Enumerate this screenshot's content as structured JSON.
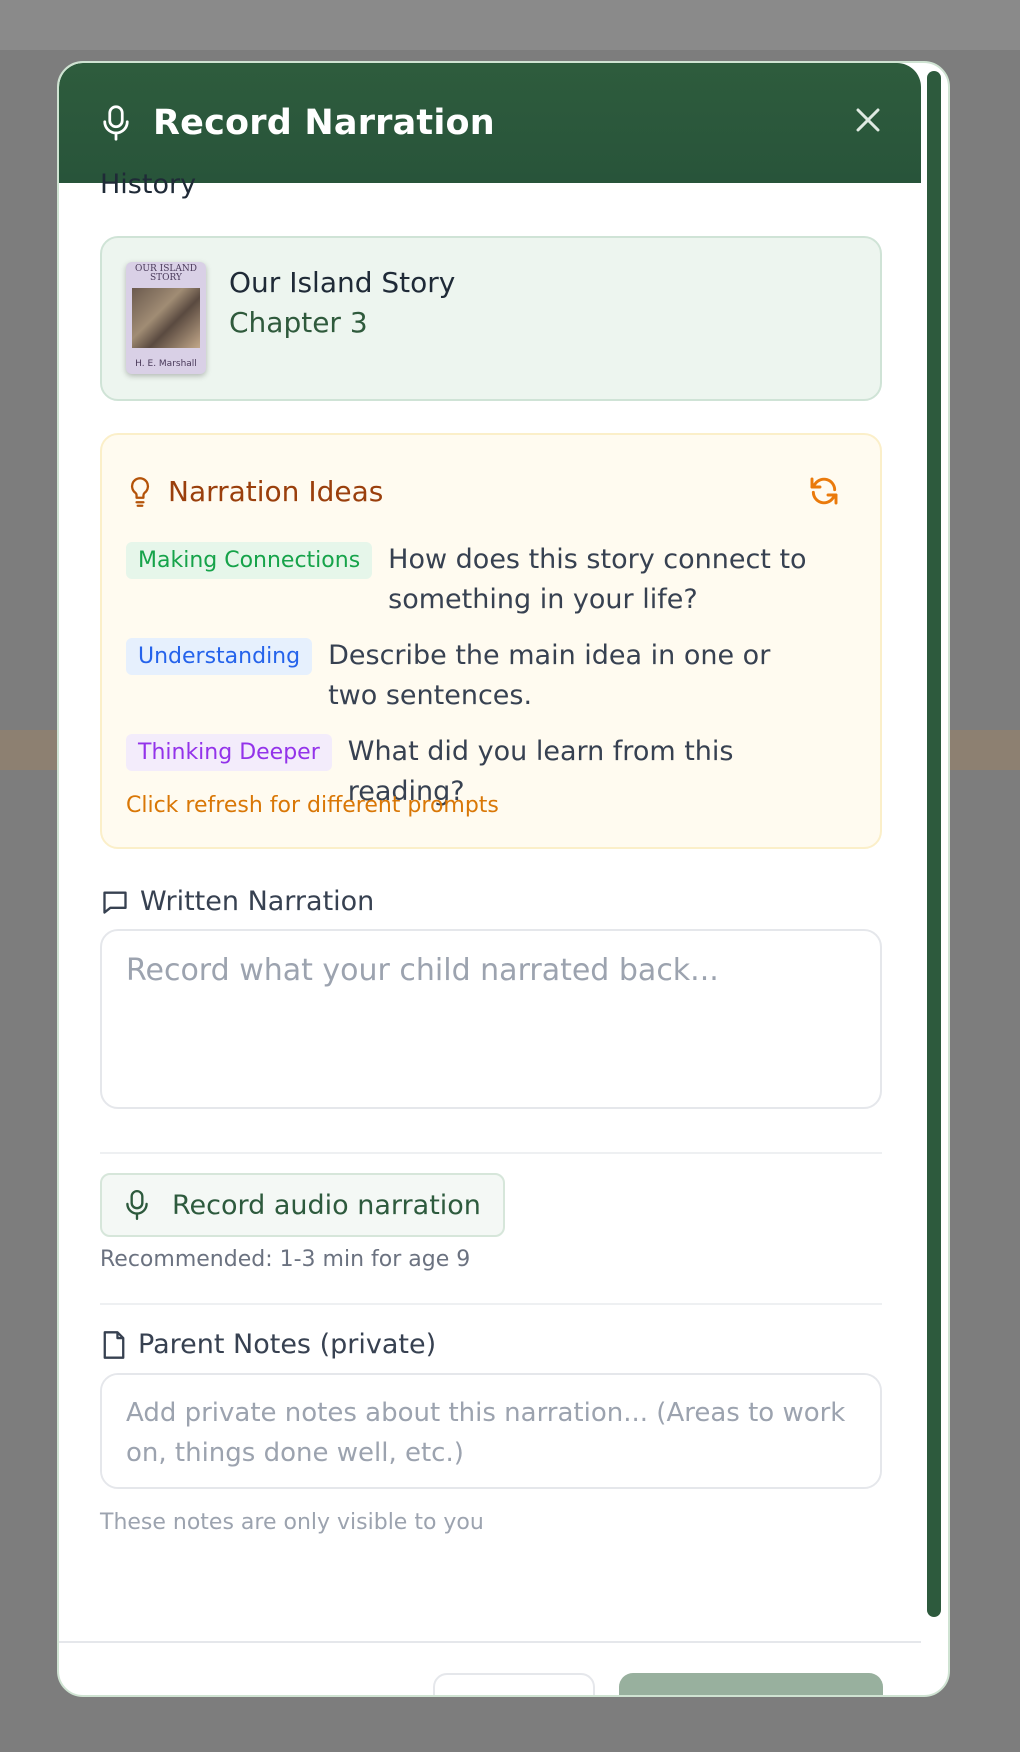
{
  "modal": {
    "title": "Record Narration",
    "subject": "History"
  },
  "book": {
    "title": "Our Island Story",
    "chapter": "Chapter 3",
    "cover_title": "OUR ISLAND STORY",
    "cover_author": "H. E. Marshall"
  },
  "ideas": {
    "heading": "Narration Ideas",
    "prompts": [
      {
        "tag": "Making Connections",
        "text": "How does this story connect to something in your life?"
      },
      {
        "tag": "Understanding",
        "text": "Describe the main idea in one or two sentences."
      },
      {
        "tag": "Thinking Deeper",
        "text": "What did you learn from this reading?"
      }
    ],
    "footer": "Click refresh for different prompts"
  },
  "written": {
    "label": "Written Narration",
    "placeholder": "Record what your child narrated back..."
  },
  "audio": {
    "button_label": "Record audio narration",
    "recommendation": "Recommended: 1-3 min for age 9"
  },
  "notes": {
    "label": "Parent Notes (private)",
    "placeholder": "Add private notes about this narration... (Areas to work on, things done well, etc.)",
    "hint": "These notes are only visible to you"
  },
  "colors": {
    "header": "#2e5c3d",
    "accent_orange": "#d97706",
    "tag_green": "#16a34a",
    "tag_blue": "#2563eb",
    "tag_purple": "#9333ea"
  },
  "icons": {
    "header": "microphone-icon",
    "close": "close-icon",
    "ideas": "lightbulb-icon",
    "refresh": "refresh-icon",
    "written": "message-square-icon",
    "audio": "microphone-icon",
    "notes": "file-icon"
  }
}
